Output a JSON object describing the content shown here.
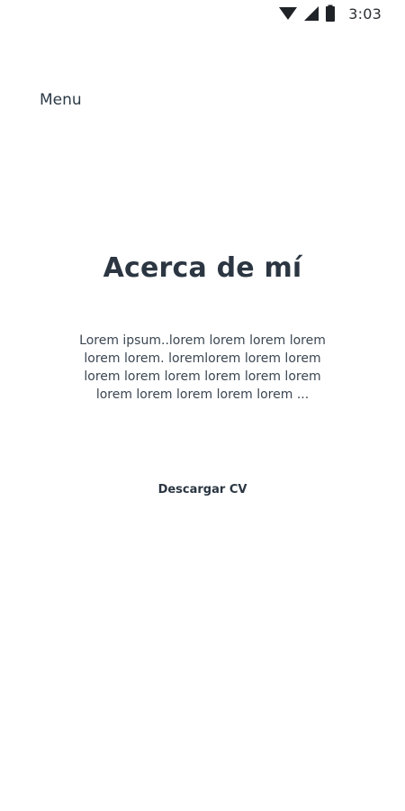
{
  "status_bar": {
    "time": "3:03",
    "icons": [
      "wifi-icon",
      "signal-icon",
      "battery-icon"
    ]
  },
  "nav": {
    "menu_label": "Menu"
  },
  "about": {
    "title": "Acerca de mí",
    "bio_lines": [
      "Lorem ipsum..lorem lorem lorem lorem",
      "lorem lorem. loremlorem lorem lorem",
      "lorem lorem lorem lorem lorem lorem",
      "lorem lorem lorem lorem lorem ..."
    ],
    "download_label": "Descargar CV"
  },
  "colors": {
    "text": "#2d3a47",
    "background": "#ffffff"
  }
}
